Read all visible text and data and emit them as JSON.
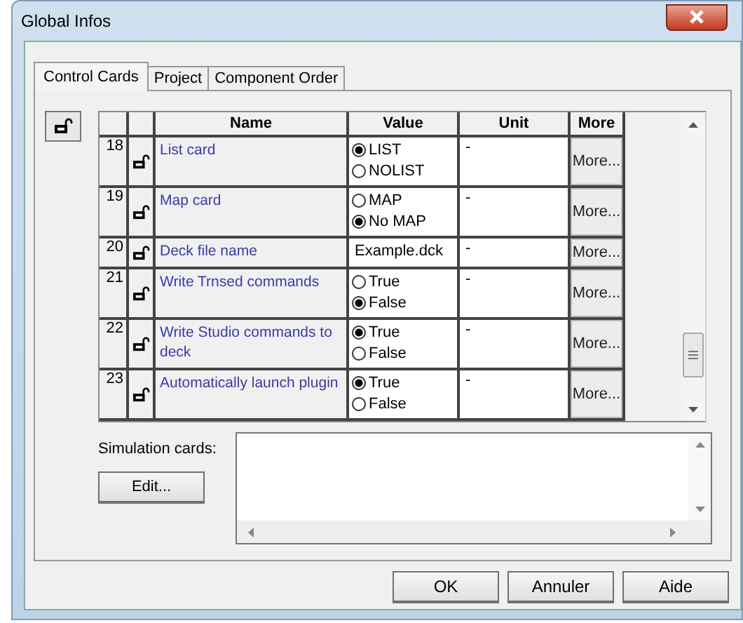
{
  "window": {
    "title": "Global Infos"
  },
  "tabs": [
    {
      "label": "Control Cards",
      "selected": true
    },
    {
      "label": "Project",
      "selected": false
    },
    {
      "label": "Component Order",
      "selected": false
    }
  ],
  "table": {
    "columns": [
      "Name",
      "Value",
      "Unit",
      "More"
    ],
    "rows": [
      {
        "index": "18",
        "name": "List card",
        "value": {
          "kind": "radio",
          "options": [
            {
              "label": "LIST",
              "selected": true
            },
            {
              "label": "NOLIST",
              "selected": false
            }
          ]
        },
        "unit": "-",
        "more": "More..."
      },
      {
        "index": "19",
        "name": "Map card",
        "value": {
          "kind": "radio",
          "options": [
            {
              "label": "MAP",
              "selected": false
            },
            {
              "label": "No MAP",
              "selected": true
            }
          ]
        },
        "unit": "-",
        "more": "More..."
      },
      {
        "index": "20",
        "name": "Deck file name",
        "value": {
          "kind": "text",
          "text": "Example.dck"
        },
        "unit": "-",
        "more": "More..."
      },
      {
        "index": "21",
        "name": "Write Trnsed commands",
        "value": {
          "kind": "radio",
          "options": [
            {
              "label": "True",
              "selected": false
            },
            {
              "label": "False",
              "selected": true
            }
          ]
        },
        "unit": "-",
        "more": "More..."
      },
      {
        "index": "22",
        "name": "Write Studio commands to deck",
        "value": {
          "kind": "radio",
          "options": [
            {
              "label": "True",
              "selected": true
            },
            {
              "label": "False",
              "selected": false
            }
          ]
        },
        "unit": "-",
        "more": "More..."
      },
      {
        "index": "23",
        "name": "Automatically launch plugin",
        "value": {
          "kind": "radio",
          "options": [
            {
              "label": "True",
              "selected": true
            },
            {
              "label": "False",
              "selected": false
            }
          ]
        },
        "unit": "-",
        "more": "More..."
      }
    ]
  },
  "simulation": {
    "label": "Simulation cards:",
    "edit_button": "Edit..."
  },
  "buttons": [
    "OK",
    "Annuler",
    "Aide"
  ]
}
